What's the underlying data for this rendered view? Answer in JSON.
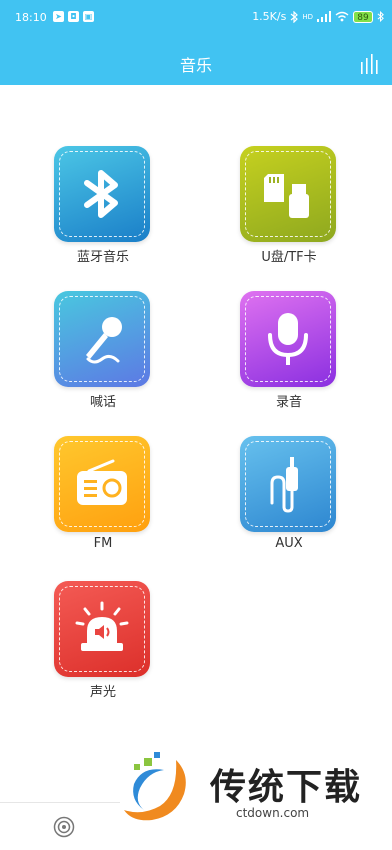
{
  "status_bar": {
    "time": "18:10",
    "speed": "1.5K/s",
    "network": "HD",
    "battery": "89"
  },
  "header": {
    "title": "音乐"
  },
  "tiles": [
    {
      "label": "蓝牙音乐",
      "icon": "bluetooth-icon",
      "colors": [
        "#4cc7e6",
        "#1a7ec8"
      ]
    },
    {
      "label": "U盘/TF卡",
      "icon": "usb-sdcard-icon",
      "colors": [
        "#c6d11f",
        "#8ea81f"
      ]
    },
    {
      "label": "喊话",
      "icon": "microphone-icon",
      "colors": [
        "#49c8df",
        "#5d78e4"
      ]
    },
    {
      "label": "录音",
      "icon": "recorder-mic-icon",
      "colors": [
        "#df72f0",
        "#8a2fe0"
      ]
    },
    {
      "label": "FM",
      "icon": "radio-icon",
      "colors": [
        "#ffc82e",
        "#ffa00f"
      ]
    },
    {
      "label": "AUX",
      "icon": "aux-cable-icon",
      "colors": [
        "#67c1ee",
        "#2d86d0"
      ]
    },
    {
      "label": "声光",
      "icon": "alarm-light-icon",
      "colors": [
        "#f45b55",
        "#dc2f2a"
      ]
    }
  ],
  "watermark": {
    "text": "传统下载",
    "url": "ctdown.com"
  }
}
